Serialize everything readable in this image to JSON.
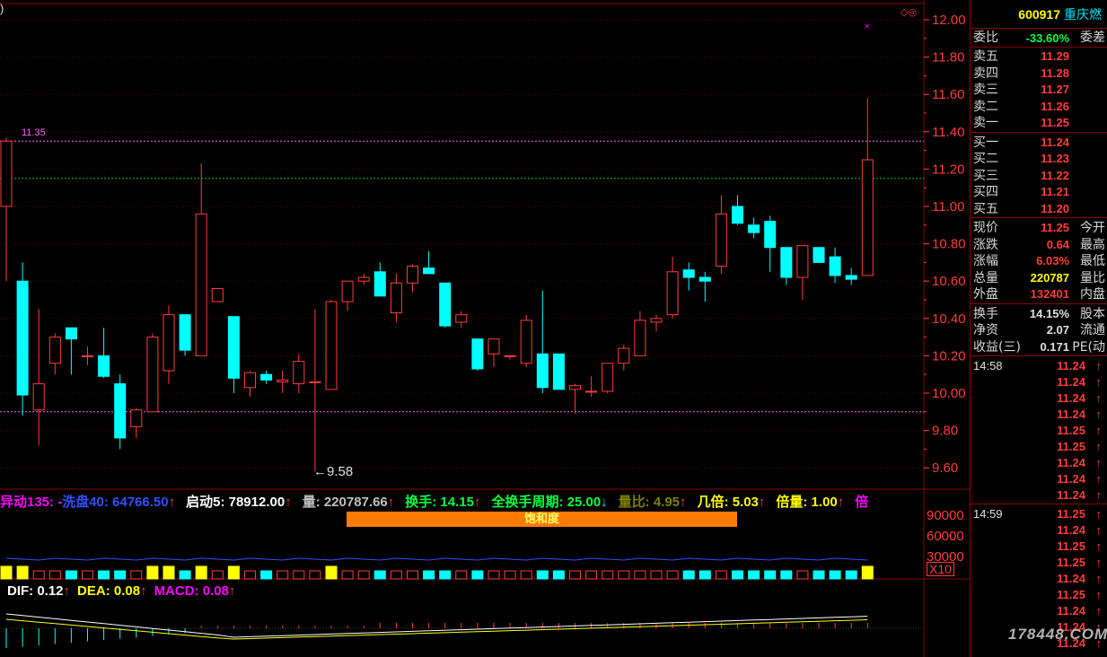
{
  "stock": {
    "code": "600917",
    "name": "重庆燃"
  },
  "price_axis": {
    "ticks": [
      "12.00",
      "11.80",
      "11.60",
      "11.40",
      "11.20",
      "11.00",
      "10.80",
      "10.60",
      "10.40",
      "10.20",
      "10.00",
      "9.80",
      "9.60"
    ]
  },
  "chart_annotations": {
    "high_line_label": "11.35",
    "low_marker_label": "←9.58",
    "corner_mark": "◇◎",
    "corner_left": ")"
  },
  "candles": [
    {
      "o": 11.0,
      "h": 11.37,
      "l": 10.6,
      "c": 11.35
    },
    {
      "o": 10.6,
      "h": 10.7,
      "l": 9.88,
      "c": 9.99
    },
    {
      "o": 9.91,
      "h": 10.45,
      "l": 9.72,
      "c": 10.05
    },
    {
      "o": 10.16,
      "h": 10.32,
      "l": 10.1,
      "c": 10.3
    },
    {
      "o": 10.35,
      "h": 10.35,
      "l": 10.1,
      "c": 10.29
    },
    {
      "o": 10.2,
      "h": 10.25,
      "l": 10.15,
      "c": 10.2
    },
    {
      "o": 10.2,
      "h": 10.35,
      "l": 10.08,
      "c": 10.09
    },
    {
      "o": 10.05,
      "h": 10.1,
      "l": 9.7,
      "c": 9.76
    },
    {
      "o": 9.82,
      "h": 9.92,
      "l": 9.76,
      "c": 9.91
    },
    {
      "o": 9.9,
      "h": 10.32,
      "l": 9.9,
      "c": 10.3
    },
    {
      "o": 10.12,
      "h": 10.47,
      "l": 10.05,
      "c": 10.42
    },
    {
      "o": 10.42,
      "h": 10.42,
      "l": 10.2,
      "c": 10.23
    },
    {
      "o": 10.2,
      "h": 11.23,
      "l": 10.2,
      "c": 10.96
    },
    {
      "o": 10.49,
      "h": 10.55,
      "l": 10.49,
      "c": 10.56
    },
    {
      "o": 10.41,
      "h": 10.41,
      "l": 10.0,
      "c": 10.08
    },
    {
      "o": 10.03,
      "h": 10.12,
      "l": 9.98,
      "c": 10.11
    },
    {
      "o": 10.1,
      "h": 10.12,
      "l": 10.05,
      "c": 10.07
    },
    {
      "o": 10.06,
      "h": 10.12,
      "l": 10.0,
      "c": 10.07
    },
    {
      "o": 10.05,
      "h": 10.21,
      "l": 10.0,
      "c": 10.17
    },
    {
      "o": 10.06,
      "h": 10.45,
      "l": 9.58,
      "c": 10.06
    },
    {
      "o": 10.02,
      "h": 10.5,
      "l": 10.02,
      "c": 10.49
    },
    {
      "o": 10.49,
      "h": 10.6,
      "l": 10.44,
      "c": 10.6
    },
    {
      "o": 10.6,
      "h": 10.64,
      "l": 10.58,
      "c": 10.62
    },
    {
      "o": 10.65,
      "h": 10.7,
      "l": 10.52,
      "c": 10.52
    },
    {
      "o": 10.43,
      "h": 10.64,
      "l": 10.38,
      "c": 10.59
    },
    {
      "o": 10.59,
      "h": 10.69,
      "l": 10.54,
      "c": 10.68
    },
    {
      "o": 10.67,
      "h": 10.76,
      "l": 10.64,
      "c": 10.64
    },
    {
      "o": 10.59,
      "h": 10.59,
      "l": 10.35,
      "c": 10.36
    },
    {
      "o": 10.38,
      "h": 10.44,
      "l": 10.35,
      "c": 10.42
    },
    {
      "o": 10.29,
      "h": 10.29,
      "l": 10.12,
      "c": 10.13
    },
    {
      "o": 10.21,
      "h": 10.29,
      "l": 10.14,
      "c": 10.29
    },
    {
      "o": 10.2,
      "h": 10.2,
      "l": 10.18,
      "c": 10.2
    },
    {
      "o": 10.16,
      "h": 10.42,
      "l": 10.14,
      "c": 10.39
    },
    {
      "o": 10.21,
      "h": 10.55,
      "l": 10.0,
      "c": 10.03
    },
    {
      "o": 10.21,
      "h": 10.2,
      "l": 10.02,
      "c": 10.02
    },
    {
      "o": 10.02,
      "h": 10.05,
      "l": 9.89,
      "c": 10.04
    },
    {
      "o": 10.01,
      "h": 10.09,
      "l": 9.98,
      "c": 10.01
    },
    {
      "o": 10.01,
      "h": 10.1,
      "l": 10.0,
      "c": 10.16
    },
    {
      "o": 10.16,
      "h": 10.26,
      "l": 10.12,
      "c": 10.24
    },
    {
      "o": 10.2,
      "h": 10.44,
      "l": 10.2,
      "c": 10.39
    },
    {
      "o": 10.38,
      "h": 10.42,
      "l": 10.33,
      "c": 10.4
    },
    {
      "o": 10.42,
      "h": 10.73,
      "l": 10.4,
      "c": 10.65
    },
    {
      "o": 10.66,
      "h": 10.7,
      "l": 10.55,
      "c": 10.62
    },
    {
      "o": 10.62,
      "h": 10.65,
      "l": 10.49,
      "c": 10.6
    },
    {
      "o": 10.68,
      "h": 11.06,
      "l": 10.64,
      "c": 10.96
    },
    {
      "o": 11.0,
      "h": 11.06,
      "l": 10.9,
      "c": 10.91
    },
    {
      "o": 10.9,
      "h": 10.94,
      "l": 10.83,
      "c": 10.86
    },
    {
      "o": 10.92,
      "h": 10.95,
      "l": 10.65,
      "c": 10.78
    },
    {
      "o": 10.78,
      "h": 10.78,
      "l": 10.58,
      "c": 10.62
    },
    {
      "o": 10.62,
      "h": 10.79,
      "l": 10.5,
      "c": 10.79
    },
    {
      "o": 10.78,
      "h": 10.78,
      "l": 10.7,
      "c": 10.7
    },
    {
      "o": 10.73,
      "h": 10.78,
      "l": 10.59,
      "c": 10.63
    },
    {
      "o": 10.63,
      "h": 10.67,
      "l": 10.58,
      "c": 10.61
    },
    {
      "o": 10.63,
      "h": 11.58,
      "l": 10.63,
      "c": 11.25
    }
  ],
  "reference_lines": {
    "pink_level": 11.35,
    "green_level": 11.15,
    "low_level": 9.9
  },
  "indicator_bar": [
    {
      "text": "异动135: -",
      "color": "#ff00ff"
    },
    {
      "text": "洗盘40: 64766.50",
      "color": "#3050ff"
    },
    {
      "text": "↑",
      "color": "#ff3b3b"
    },
    {
      "text": "启动5: 78912.00",
      "color": "#ffffff"
    },
    {
      "text": "↑",
      "color": "#ff3b3b"
    },
    {
      "text": "量: 220787.66",
      "color": "#c0c0c0"
    },
    {
      "text": "↑",
      "color": "#ff3b3b"
    },
    {
      "text": "换手: 14.15",
      "color": "#00ff40"
    },
    {
      "text": "↑",
      "color": "#ff3b3b"
    },
    {
      "text": "全换手周期: 25.00",
      "color": "#00ff40"
    },
    {
      "text": "↓",
      "color": "#00e5ff"
    },
    {
      "text": "量比: 4.95",
      "color": "#808000"
    },
    {
      "text": "↑",
      "color": "#ff3b3b"
    },
    {
      "text": "几倍: 5.03",
      "color": "#ffff00"
    },
    {
      "text": "↑",
      "color": "#ff3b3b"
    },
    {
      "text": "倍量: 1.00",
      "color": "#ffff00"
    },
    {
      "text": "↑",
      "color": "#ff3b3b"
    },
    {
      "text": "倍",
      "color": "#ff00ff"
    }
  ],
  "saturation_label": "饱和度",
  "volume_axis": {
    "ticks": [
      "90000",
      "60000",
      "30000"
    ],
    "multiplier": "X10"
  },
  "macd_bar": [
    {
      "text": "DIF: 0.12",
      "color": "#ffffff"
    },
    {
      "text": "↑",
      "color": "#ff3b3b"
    },
    {
      "text": "DEA: 0.08",
      "color": "#ffff00"
    },
    {
      "text": "↑",
      "color": "#ff3b3b"
    },
    {
      "text": "MACD: 0.08",
      "color": "#ff00ff"
    },
    {
      "text": "↑",
      "color": "#ff3b3b"
    }
  ],
  "quote": {
    "weibi_label": "委比",
    "weibi_value": "-33.60%",
    "weicha_label": "委差",
    "asks": [
      {
        "label": "卖五",
        "price": "11.29"
      },
      {
        "label": "卖四",
        "price": "11.28"
      },
      {
        "label": "卖三",
        "price": "11.27"
      },
      {
        "label": "卖二",
        "price": "11.26"
      },
      {
        "label": "卖一",
        "price": "11.25"
      }
    ],
    "bids": [
      {
        "label": "买一",
        "price": "11.24"
      },
      {
        "label": "买二",
        "price": "11.23"
      },
      {
        "label": "买三",
        "price": "11.22"
      },
      {
        "label": "买四",
        "price": "11.21"
      },
      {
        "label": "买五",
        "price": "11.20"
      }
    ],
    "stats1": [
      {
        "label": "现价",
        "value": "11.25",
        "label2": "今开",
        "color": "red"
      },
      {
        "label": "涨跌",
        "value": "0.64",
        "label2": "最高",
        "color": "red"
      },
      {
        "label": "涨幅",
        "value": "6.03%",
        "label2": "最低",
        "color": "red"
      },
      {
        "label": "总量",
        "value": "220787",
        "label2": "量比",
        "color": "yellow"
      },
      {
        "label": "外盘",
        "value": "132401",
        "label2": "内盘",
        "color": "red"
      }
    ],
    "stats2": [
      {
        "label": "换手",
        "value": "14.15%",
        "label2": "股本",
        "color": "white"
      },
      {
        "label": "净资",
        "value": "2.07",
        "label2": "流通",
        "color": "white"
      },
      {
        "label": "收益(三)",
        "value": "0.171",
        "label2": "PE(动",
        "color": "white"
      }
    ],
    "ticks_1458": {
      "time": "14:58",
      "prices": [
        "11.24",
        "11.24",
        "11.24",
        "11.24",
        "11.25",
        "11.25",
        "11.24",
        "11.24",
        "11.24"
      ]
    },
    "ticks_1459": {
      "time": "14:59",
      "prices": [
        "11.25",
        "11.24",
        "11.25",
        "11.25",
        "11.24",
        "11.25",
        "11.24",
        "11.24",
        "11.24"
      ]
    },
    "tick_arrow": "↑"
  },
  "watermark": "178448.COM"
}
